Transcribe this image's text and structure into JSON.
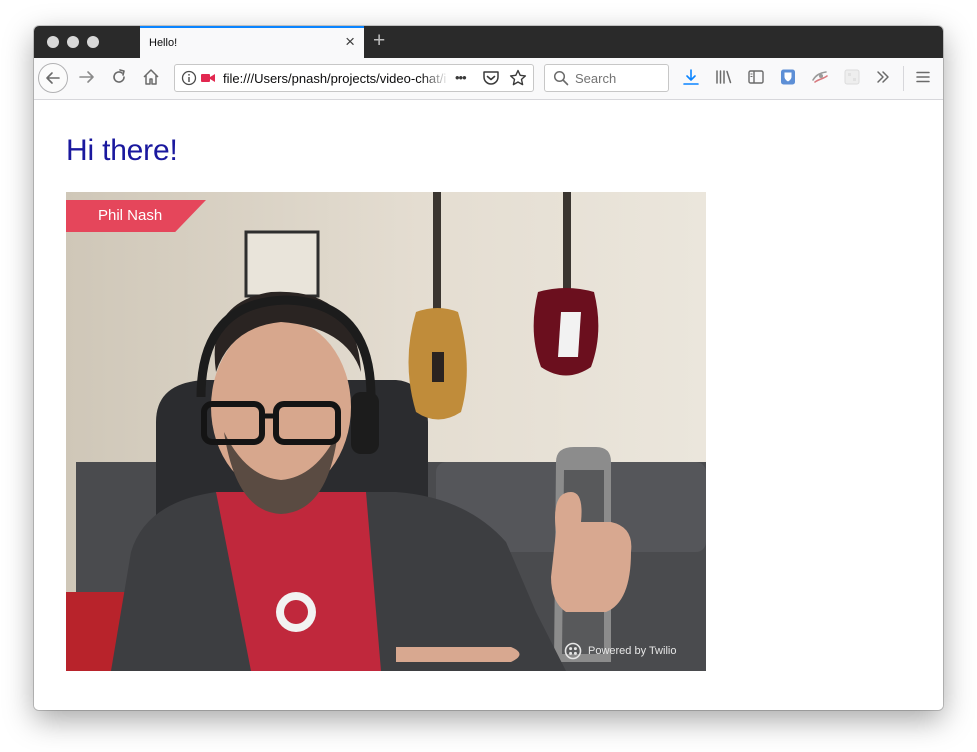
{
  "browser": {
    "tab_title": "Hello!",
    "url": "file:///Users/pnash/projects/video-chat/index.html",
    "search_placeholder": "Search",
    "more_label": "•••"
  },
  "page": {
    "heading": "Hi there!"
  },
  "video": {
    "participant_name": "Phil Nash",
    "powered_by": "Powered by Twilio"
  },
  "colors": {
    "heading": "#1a189e",
    "name_tag": "#e5465b",
    "tab_accent": "#0a84ff",
    "camera_icon": "#e22850",
    "download_icon": "#0a84ff"
  }
}
